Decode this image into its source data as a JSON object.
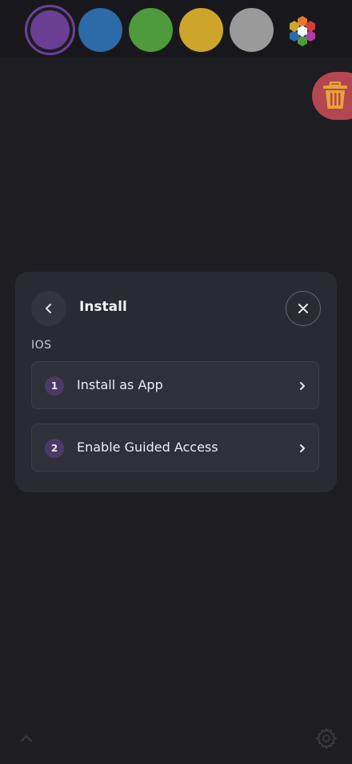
{
  "color_swatches": [
    {
      "name": "purple",
      "color": "#6a3f93",
      "selected": true
    },
    {
      "name": "blue",
      "color": "#2d6aa8"
    },
    {
      "name": "green",
      "color": "#4f9a3a"
    },
    {
      "name": "yellow",
      "color": "#cda52b"
    },
    {
      "name": "gray",
      "color": "#9a9a9a"
    }
  ],
  "colors": {
    "background": "#1d1d22",
    "modal": "#2a2a32",
    "trash_button": "#b4464f",
    "trash_icon": "#e8a33a",
    "step_badge": "#4a3a66"
  },
  "icons": {
    "palette": "multicolor-hexagon-icon",
    "trash": "trash-icon",
    "back": "chevron-left-icon",
    "close": "close-icon",
    "step_chevron": "chevron-right-icon",
    "bottom": "chevron-up-icon",
    "settings": "gear-icon"
  },
  "modal": {
    "title": "Install",
    "section_label": "IOS",
    "steps": [
      {
        "number": "1",
        "label": "Install as App"
      },
      {
        "number": "2",
        "label": "Enable Guided Access"
      }
    ]
  }
}
